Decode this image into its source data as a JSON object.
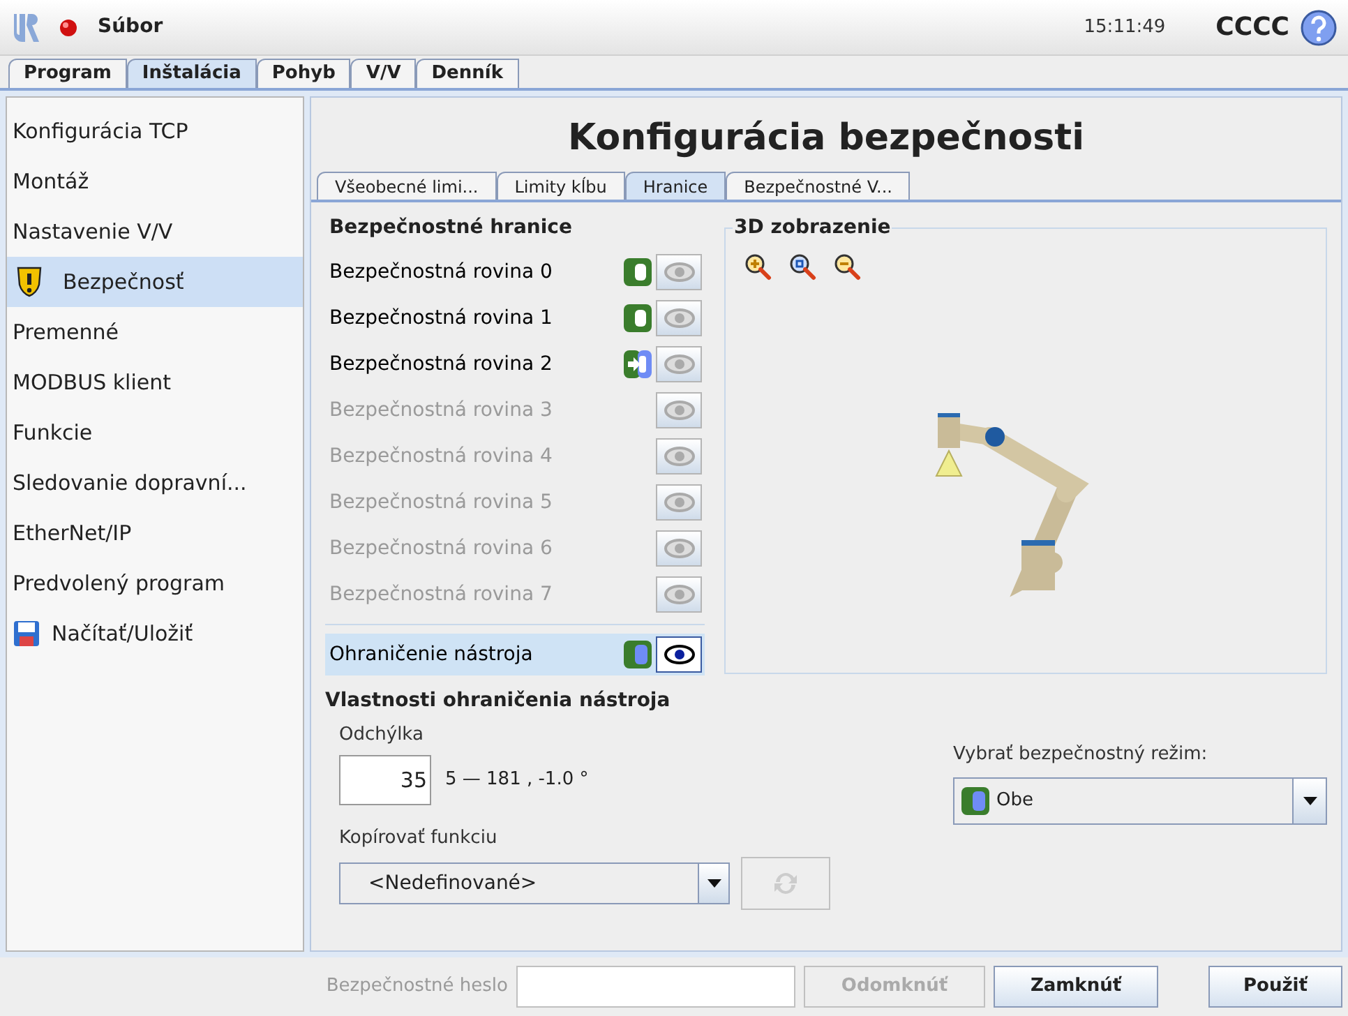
{
  "header": {
    "menu": "Súbor",
    "time": "15:11:49",
    "robot_name": "CCCC"
  },
  "tabs": [
    {
      "label": "Program",
      "selected": false
    },
    {
      "label": "Inštalácia",
      "selected": true
    },
    {
      "label": "Pohyb",
      "selected": false
    },
    {
      "label": "V/V",
      "selected": false
    },
    {
      "label": "Denník",
      "selected": false
    }
  ],
  "sidebar": {
    "items": [
      {
        "label": "Konfigurácia TCP",
        "selected": false,
        "kind": "plain"
      },
      {
        "label": "Montáž",
        "selected": false,
        "kind": "plain"
      },
      {
        "label": "Nastavenie V/V",
        "selected": false,
        "kind": "plain"
      },
      {
        "label": "Bezpečnosť",
        "selected": true,
        "kind": "warning"
      },
      {
        "label": "Premenné",
        "selected": false,
        "kind": "plain"
      },
      {
        "label": "MODBUS klient",
        "selected": false,
        "kind": "plain"
      },
      {
        "label": "Funkcie",
        "selected": false,
        "kind": "plain"
      },
      {
        "label": "Sledovanie dopravní...",
        "selected": false,
        "kind": "plain"
      },
      {
        "label": "EtherNet/IP",
        "selected": false,
        "kind": "plain"
      },
      {
        "label": "Predvolený program",
        "selected": false,
        "kind": "plain"
      },
      {
        "label": "Načítať/Uložiť",
        "selected": false,
        "kind": "disk"
      }
    ]
  },
  "page_title": "Konfigurácia bezpečnosti",
  "subtabs": [
    {
      "label": "Všeobecné limi...",
      "selected": false
    },
    {
      "label": "Limity kĺbu",
      "selected": false
    },
    {
      "label": "Hranice",
      "selected": true
    },
    {
      "label": "Bezpečnostné V...",
      "selected": false
    }
  ],
  "boundaries": {
    "title": "Bezpečnostné hranice",
    "planes": [
      {
        "label": "Bezpečnostná rovina 0",
        "enabled": true,
        "kind": "normal",
        "visible": false,
        "selected": false
      },
      {
        "label": "Bezpečnostná rovina 1",
        "enabled": true,
        "kind": "normal",
        "visible": false,
        "selected": false
      },
      {
        "label": "Bezpečnostná rovina 2",
        "enabled": true,
        "kind": "trigger",
        "visible": false,
        "selected": false
      },
      {
        "label": "Bezpečnostná rovina 3",
        "enabled": false,
        "kind": "inactive",
        "visible": false,
        "selected": false
      },
      {
        "label": "Bezpečnostná rovina 4",
        "enabled": false,
        "kind": "inactive",
        "visible": false,
        "selected": false
      },
      {
        "label": "Bezpečnostná rovina 5",
        "enabled": false,
        "kind": "inactive",
        "visible": false,
        "selected": false
      },
      {
        "label": "Bezpečnostná rovina 6",
        "enabled": false,
        "kind": "inactive",
        "visible": false,
        "selected": false
      },
      {
        "label": "Bezpečnostná rovina 7",
        "enabled": false,
        "kind": "inactive",
        "visible": false,
        "selected": false
      }
    ],
    "tool": {
      "label": "Ohraničenie nástroja",
      "enabled": true,
      "kind": "both",
      "visible": true,
      "selected": true
    }
  },
  "view3d": {
    "title": "3D zobrazenie"
  },
  "properties": {
    "title": "Vlastnosti ohraničenia nástroja",
    "deviation_label": "Odchýlka",
    "deviation_value": "35",
    "deviation_range": "5 — 181 , -1.0 °",
    "copy_label": "Kopírovať funkciu",
    "copy_value": "<Nedefinované>",
    "mode_label": "Vybrať bezpečnostný režim:",
    "mode_value": "Obe"
  },
  "footer": {
    "password_label": "Bezpečnostné heslo",
    "unlock": "Odomknúť",
    "lock": "Zamknúť",
    "apply": "Použiť"
  }
}
